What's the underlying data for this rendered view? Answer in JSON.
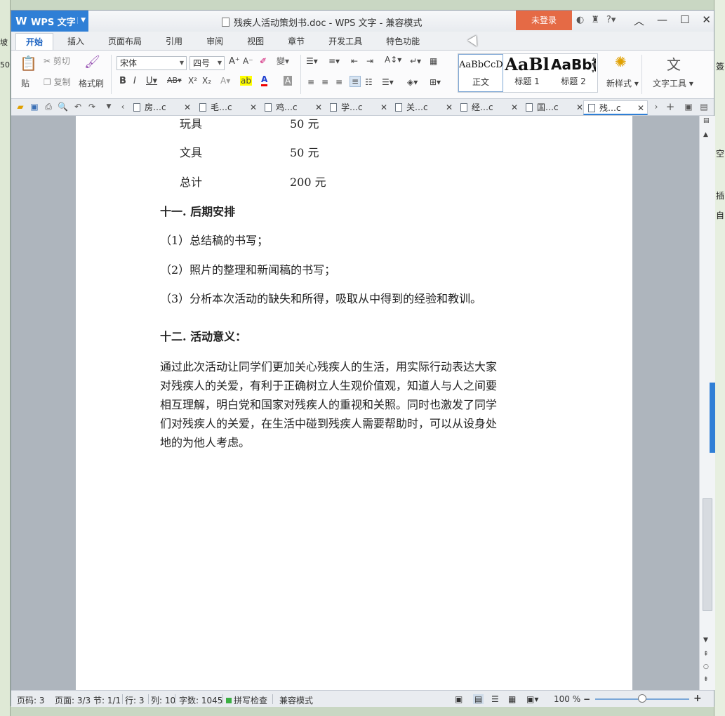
{
  "window": {
    "app_name": "WPS 文字",
    "title": "残疾人活动策划书.doc - WPS 文字 - 兼容模式",
    "login_label": "未登录"
  },
  "menu_tabs": [
    "开始",
    "插入",
    "页面布局",
    "引用",
    "审阅",
    "视图",
    "章节",
    "开发工具",
    "特色功能"
  ],
  "ribbon": {
    "paste_label": "贴",
    "cut_label": "剪切",
    "copy_label": "复制",
    "format_painter_label": "格式刷",
    "font_name": "宋体",
    "font_size": "四号",
    "styles": [
      {
        "sample": "AaBbCcD",
        "label": "正文"
      },
      {
        "sample": "AaBl",
        "label": "标题 1"
      },
      {
        "sample": "AaBb(",
        "label": "标题 2"
      }
    ],
    "new_style_label": "新样式",
    "text_tools_label": "文字工具"
  },
  "doc_tabs": [
    {
      "label": "房…c",
      "active": false
    },
    {
      "label": "毛…c",
      "active": false
    },
    {
      "label": "鸡…c",
      "active": false
    },
    {
      "label": "学…c",
      "active": false
    },
    {
      "label": "关…c",
      "active": false
    },
    {
      "label": "经…c",
      "active": false
    },
    {
      "label": "国…c",
      "active": false
    },
    {
      "label": "残…c",
      "active": true
    }
  ],
  "document": {
    "budget_rows": [
      {
        "item": "玩具",
        "amount": "50 元"
      },
      {
        "item": "文具",
        "amount": "50 元"
      },
      {
        "item": "总计",
        "amount": "200 元"
      }
    ],
    "section11_heading": "十一. 后期安排",
    "section11_items": [
      "（1）总结稿的书写；",
      "（2）照片的整理和新闻稿的书写；",
      "（3）分析本次活动的缺失和所得，吸取从中得到的经验和教训。"
    ],
    "section12_heading": "十二. 活动意义：",
    "section12_paragraph_lines": [
      "通过此次活动让同学们更加关心残疾人的生活，用实际行动表达大家",
      "对残疾人的关爱，有利于正确树立人生观价值观，知道人与人之间要",
      "相互理解，明白党和国家对残疾人的重视和关照。同时也激发了同学",
      "们对残疾人的关爱，在生活中碰到残疾人需要帮助时，可以从设身处",
      "地的为他人考虑。"
    ]
  },
  "statusbar": {
    "page_code": "页码: 3",
    "pages": "页面: 3/3",
    "section": "节: 1/1",
    "row": "行: 3",
    "column": "列: 10",
    "word_count": "字数: 1045",
    "spell_check": "拼写检查",
    "compat_mode": "兼容模式",
    "zoom": "100 %",
    "zoom_level": 1.0
  },
  "background_fragments": {
    "left": [
      "50(",
      "坡"
    ],
    "right": [
      "空",
      "插",
      "自",
      "簽"
    ]
  }
}
